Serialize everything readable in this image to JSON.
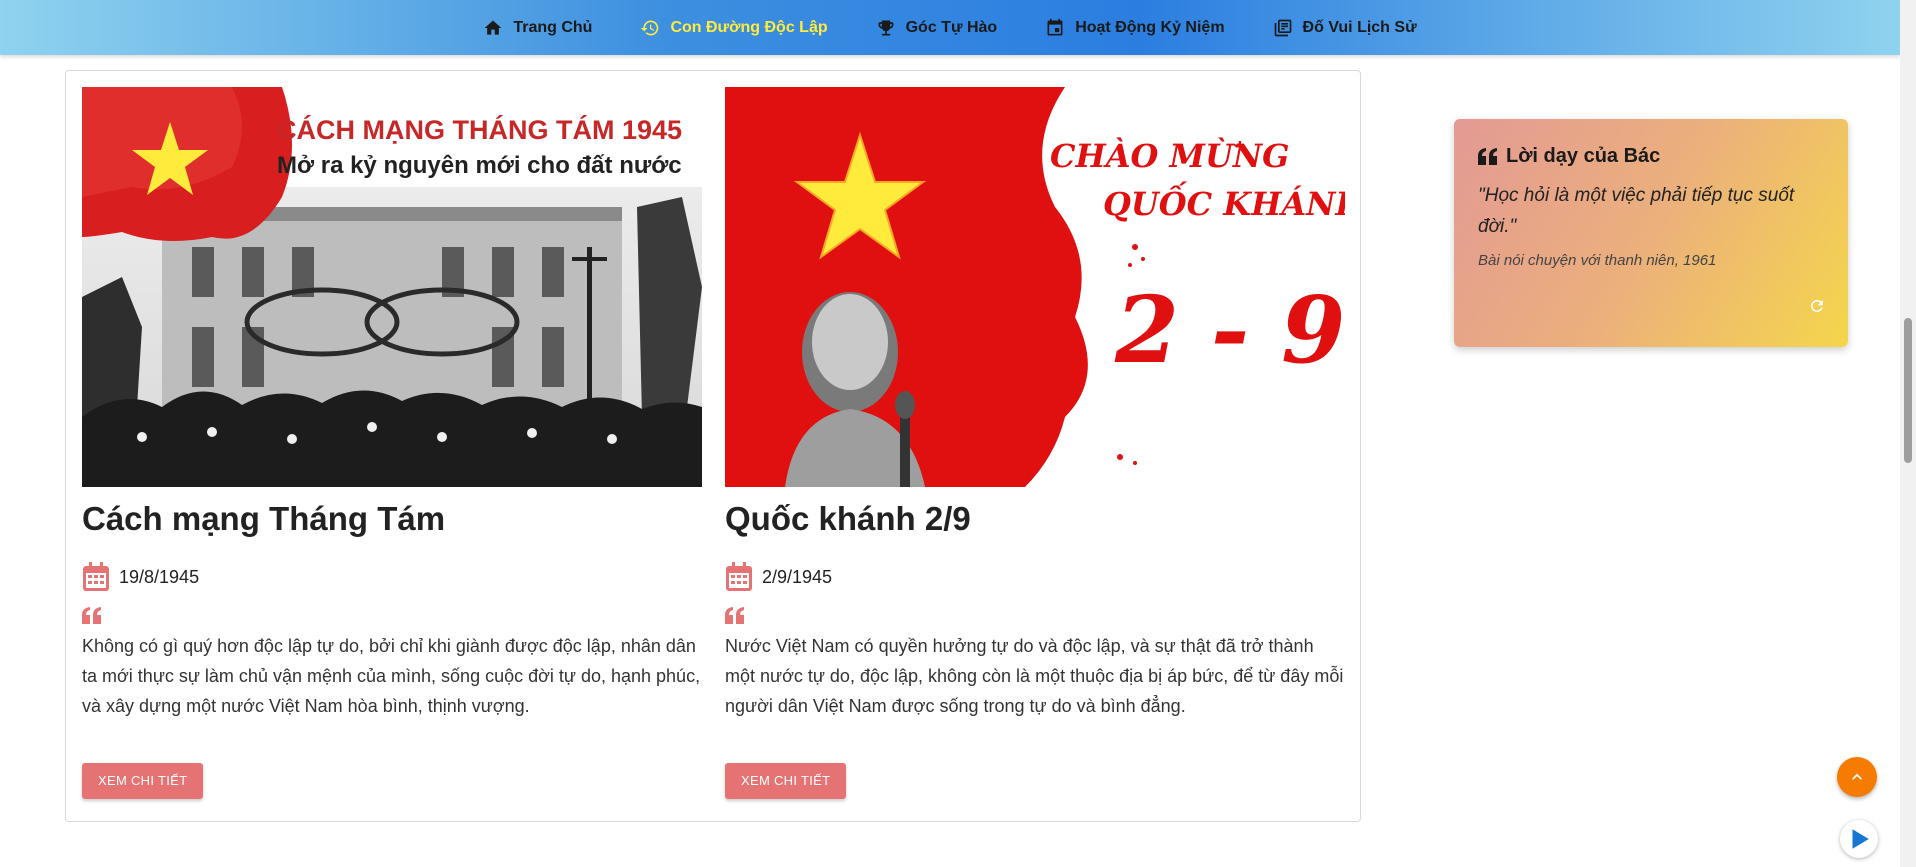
{
  "nav": {
    "items": [
      {
        "label": "Trang Chủ",
        "icon": "home-icon"
      },
      {
        "label": "Con Đường Độc Lập",
        "icon": "history-icon",
        "active": true
      },
      {
        "label": "Góc Tự Hào",
        "icon": "trophy-icon"
      },
      {
        "label": "Hoạt Động Kỷ Niệm",
        "icon": "calendar-icon"
      },
      {
        "label": "Đố Vui Lịch Sử",
        "icon": "quiz-icon"
      }
    ]
  },
  "events": [
    {
      "image_heading": "CÁCH MẠNG THÁNG TÁM 1945",
      "image_subheading": "Mở ra kỷ nguyên mới cho đất nước",
      "title": "Cách mạng Tháng Tám",
      "date": "19/8/1945",
      "text": "Không có gì quý hơn độc lập tự do, bởi chỉ khi giành được độc lập, nhân dân ta mới thực sự làm chủ vận mệnh của mình, sống cuộc đời tự do, hạnh phúc, và xây dựng một nước Việt Nam hòa bình, thịnh vượng.",
      "button": "XEM CHI TIẾT"
    },
    {
      "image_heading": "CHÀO MỪNG",
      "image_subheading": "QUỐC KHÁNH",
      "image_number": "2 - 9",
      "title": "Quốc khánh 2/9",
      "date": "2/9/1945",
      "text": "Nước Việt Nam có quyền hưởng tự do và độc lập, và sự thật đã trở thành một nước tự do, độc lập, không còn là một thuộc địa bị áp bức, để từ đây mỗi người dân Việt Nam được sống trong tự do và bình đẳng.",
      "button": "XEM CHI TIẾT"
    }
  ],
  "quote_card": {
    "title": "Lời dạy của Bác",
    "text": "\"Học hỏi là một việc phải tiếp tục suốt đời.\"",
    "source": "Bài nói chuyện với thanh niên, 1961"
  },
  "colors": {
    "accent": "#e57373",
    "active_nav": "#ffeb3b",
    "back_to_top": "#f57c00",
    "play": "#1976d2"
  }
}
